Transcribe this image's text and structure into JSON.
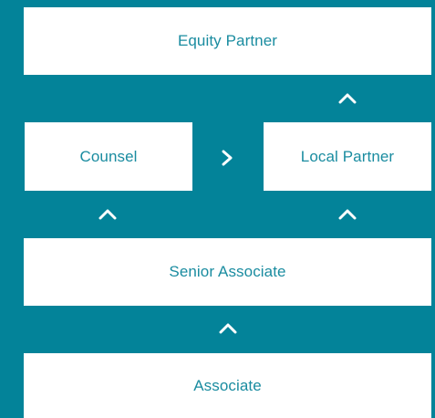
{
  "colors": {
    "background": "#038399",
    "box_fill": "#ffffff",
    "box_text": "#1a8ca0",
    "arrow": "#ffffff"
  },
  "roles": {
    "equity_partner": "Equity Partner",
    "counsel": "Counsel",
    "local_partner": "Local Partner",
    "senior_associate": "Senior Associate",
    "associate": "Associate"
  },
  "arrows": [
    {
      "from": "local_partner",
      "to": "equity_partner",
      "icon": "chevron-up-icon"
    },
    {
      "from": "counsel",
      "to": "local_partner",
      "icon": "chevron-right-icon"
    },
    {
      "from": "senior_associate",
      "to": "counsel",
      "icon": "chevron-up-icon"
    },
    {
      "from": "senior_associate",
      "to": "local_partner",
      "icon": "chevron-up-icon"
    },
    {
      "from": "associate",
      "to": "senior_associate",
      "icon": "chevron-up-icon"
    }
  ]
}
